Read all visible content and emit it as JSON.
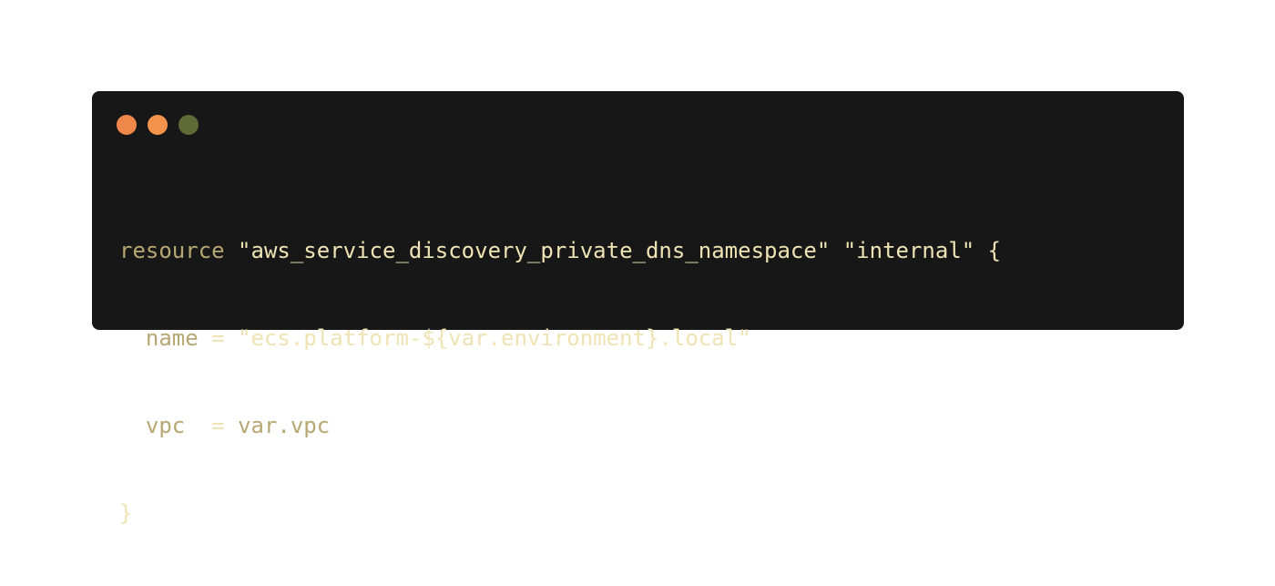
{
  "window": {
    "controls": {
      "close_color": "#f0874a",
      "minimize_color": "#f4934c",
      "maximize_color": "#5e6b37"
    }
  },
  "code": {
    "language": "hcl",
    "lines": [
      {
        "keyword": "resource",
        "type": "\"aws_service_discovery_private_dns_namespace\"",
        "name": "\"internal\"",
        "brace": "{"
      },
      {
        "indent": "  ",
        "attr": "name",
        "op": " = ",
        "value": "\"ecs.platform-${var.environment}.local\""
      },
      {
        "indent": "  ",
        "attr": "vpc",
        "op": "  = ",
        "value": "var.vpc"
      },
      {
        "brace": "}"
      }
    ]
  }
}
